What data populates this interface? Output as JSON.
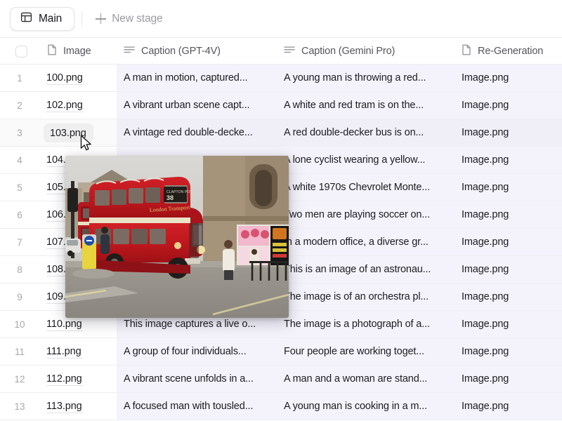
{
  "stagebar": {
    "tab_label": "Main",
    "tab_icon": "table-grid-icon",
    "new_stage_label": "New stage"
  },
  "table": {
    "columns": [
      {
        "key": "select",
        "label": "",
        "icon": "checkbox-icon"
      },
      {
        "key": "index",
        "label": "",
        "icon": ""
      },
      {
        "key": "image",
        "label": "Image",
        "icon": "file-icon"
      },
      {
        "key": "gpt4v",
        "label": "Caption (GPT-4V)",
        "icon": "text-lines-icon"
      },
      {
        "key": "gemini",
        "label": "Caption (Gemini Pro)",
        "icon": "text-lines-icon"
      },
      {
        "key": "regen",
        "label": "Re-Generation",
        "icon": "file-icon"
      }
    ],
    "rows": [
      {
        "index": "1",
        "image": "100.png",
        "gpt4v": "A man in motion, captured...",
        "gemini": "A young man is throwing a red...",
        "regen": "Image.png",
        "hover": false
      },
      {
        "index": "2",
        "image": "102.png",
        "gpt4v": "A vibrant urban scene capt...",
        "gemini": "A white and red tram is on the...",
        "regen": "Image.png",
        "hover": false
      },
      {
        "index": "3",
        "image": "103.png",
        "gpt4v": "A vintage red double-decke...",
        "gemini": "A red double-decker bus is on...",
        "regen": "Image.png",
        "hover": true
      },
      {
        "index": "4",
        "image": "104.png",
        "gpt4v": "",
        "gemini": "A lone cyclist wearing a yellow...",
        "regen": "Image.png",
        "hover": false
      },
      {
        "index": "5",
        "image": "105.png",
        "gpt4v": "",
        "gemini": "A white 1970s Chevrolet Monte...",
        "regen": "Image.png",
        "hover": false
      },
      {
        "index": "6",
        "image": "106.png",
        "gpt4v": "",
        "gemini": "Two men are playing soccer on...",
        "regen": "Image.png",
        "hover": false
      },
      {
        "index": "7",
        "image": "107.png",
        "gpt4v": "",
        "gemini": "In a modern office, a diverse gr...",
        "regen": "Image.png",
        "hover": false
      },
      {
        "index": "8",
        "image": "108.png",
        "gpt4v": "",
        "gemini": "This is an image of an astronau...",
        "regen": "Image.png",
        "hover": false
      },
      {
        "index": "9",
        "image": "109.png",
        "gpt4v": "",
        "gemini": "The image is of an orchestra pl...",
        "regen": "Image.png",
        "hover": false
      },
      {
        "index": "10",
        "image": "110.png",
        "gpt4v": "This image captures a live o...",
        "gemini": "The image is a photograph of a...",
        "regen": "Image.png",
        "hover": false
      },
      {
        "index": "11",
        "image": "111.png",
        "gpt4v": "A group of four individuals...",
        "gemini": "Four people are working toget...",
        "regen": "Image.png",
        "hover": false
      },
      {
        "index": "12",
        "image": "112.png",
        "gpt4v": "A vibrant scene unfolds in a...",
        "gemini": "A man and a woman are stand...",
        "regen": "Image.png",
        "hover": false
      },
      {
        "index": "13",
        "image": "113.png",
        "gpt4v": "A focused man with tousled...",
        "gemini": "A young man is cooking in a m...",
        "regen": "Image.png",
        "hover": false
      }
    ]
  },
  "preview": {
    "alt": "Red vintage double-decker bus route 38 Clapton Pond on a city street",
    "source_row": "3",
    "source_file": "103.png"
  },
  "colors": {
    "row_tint": "#f4f3fb",
    "page_bg": "#ffffff",
    "text_primary": "#1b1c20",
    "text_muted": "#9a9aa2",
    "border": "#eeeef0",
    "bus_red": "#c0181f"
  }
}
